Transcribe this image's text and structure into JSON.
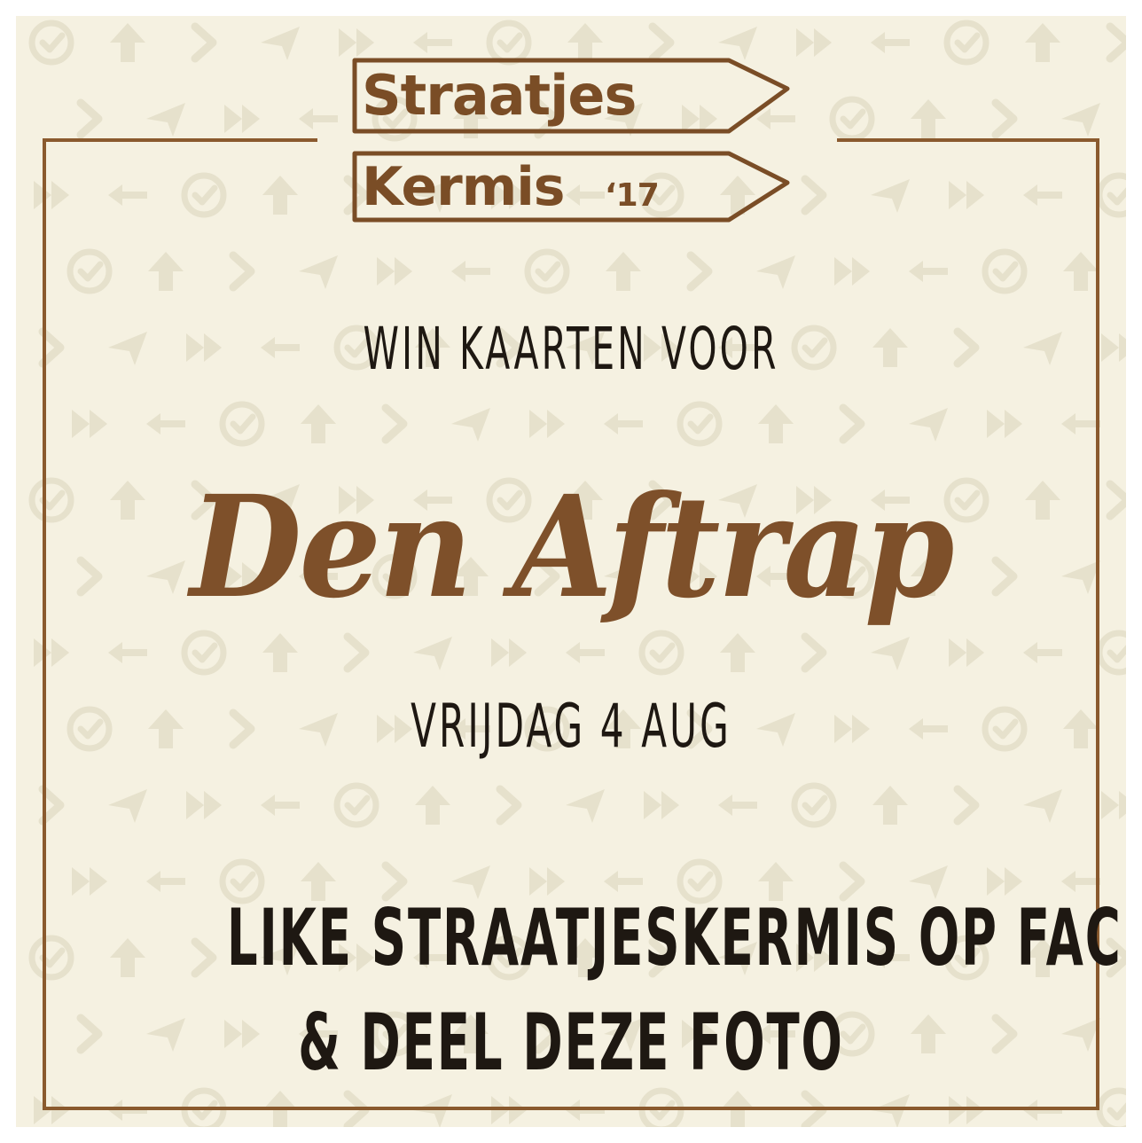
{
  "logo": {
    "line1": "Straatjes",
    "line2": "Kermis",
    "year": "‘17"
  },
  "headline": "WIN KAARTEN VOOR",
  "event_name": "Den Aftrap",
  "event_date": "VRIJDAG 4 AUG",
  "cta": {
    "line1": "LIKE STRAATJESKERMIS OP FACEBOOK",
    "line2": "& DEEL DEZE FOTO"
  },
  "colors": {
    "background": "#f5f1e1",
    "accent_brown": "#7e502a",
    "text_dark": "#1e1812",
    "pattern": "#e6e1cc"
  }
}
